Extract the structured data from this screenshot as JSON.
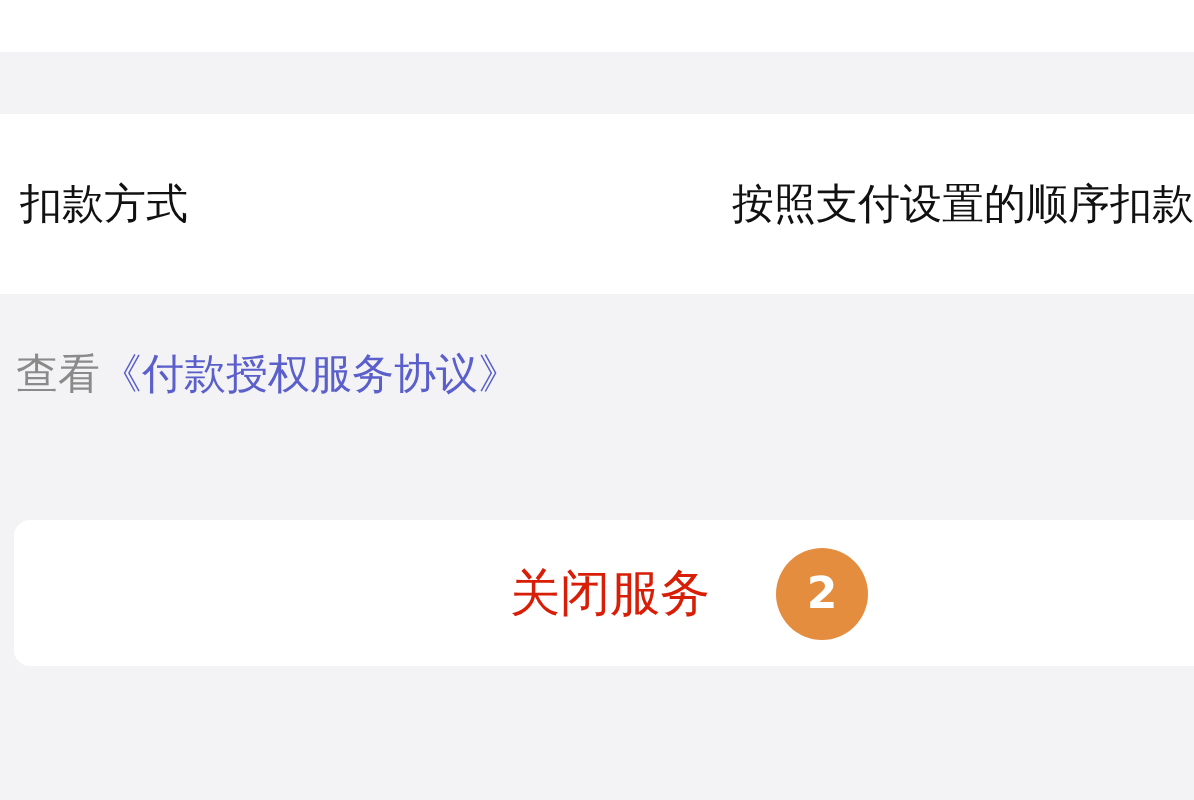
{
  "payment_method": {
    "label": "扣款方式",
    "value": "按照支付设置的顺序扣款"
  },
  "agreement": {
    "prefix": "查看",
    "link": "《付款授权服务协议》"
  },
  "close_button": {
    "label": "关闭服务",
    "badge": "2"
  }
}
